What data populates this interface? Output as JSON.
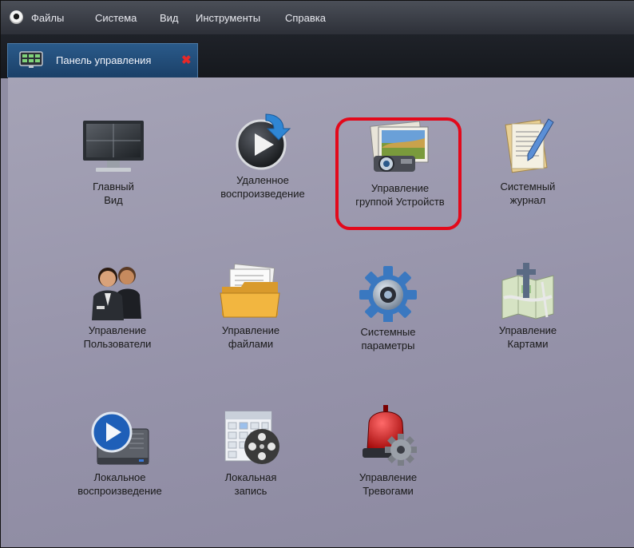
{
  "menu": {
    "items": [
      "Файлы",
      "Система",
      "Вид",
      "Инструменты",
      "Справка"
    ]
  },
  "tab": {
    "label": "Панель управления",
    "close": "✖"
  },
  "tiles": [
    {
      "id": "main-view",
      "label": "Главный\nВид",
      "icon": "monitor-icon"
    },
    {
      "id": "remote-playback",
      "label": "Удаленное\nвоспроизведение",
      "icon": "play-arrow-icon"
    },
    {
      "id": "device-group",
      "label": "Управление\nгруппой Устройств",
      "icon": "photo-camera-icon"
    },
    {
      "id": "system-log",
      "label": "Системный\nжурнал",
      "icon": "notepad-pen-icon"
    },
    {
      "id": "users",
      "label": "Управление\nПользователи",
      "icon": "users-icon"
    },
    {
      "id": "files",
      "label": "Управление\nфайлами",
      "icon": "folder-icon"
    },
    {
      "id": "system-params",
      "label": "Системные\nпараметры",
      "icon": "gear-icon"
    },
    {
      "id": "maps",
      "label": "Управление\nКартами",
      "icon": "map-icon"
    },
    {
      "id": "local-playback",
      "label": "Локальное\nвоспроизведение",
      "icon": "local-play-icon"
    },
    {
      "id": "local-record",
      "label": "Локальная\nзапись",
      "icon": "calendar-film-icon"
    },
    {
      "id": "alarms",
      "label": "Управление\nТревогами",
      "icon": "alarm-siren-icon"
    }
  ],
  "colors": {
    "highlight": "#e3091b",
    "content_bg": "#9693aa"
  }
}
